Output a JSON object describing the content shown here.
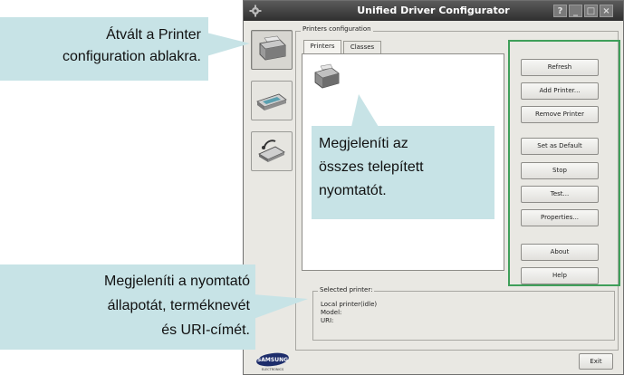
{
  "window": {
    "title": "Unified Driver Configurator",
    "controls": [
      "?",
      "_",
      "□",
      "×"
    ]
  },
  "nav": {
    "items": [
      {
        "name": "printer",
        "active": true
      },
      {
        "name": "scanner",
        "active": false
      },
      {
        "name": "ports",
        "active": false
      }
    ]
  },
  "printers_config": {
    "group_label": "Printers configuration",
    "tabs": [
      {
        "label": "Printers",
        "active": true
      },
      {
        "label": "Classes",
        "active": false
      }
    ],
    "buttons": {
      "refresh": "Refresh",
      "add_printer": "Add Printer...",
      "remove_printer": "Remove Printer",
      "set_default": "Set as Default",
      "stop": "Stop",
      "test": "Test...",
      "properties": "Properties...",
      "about": "About",
      "help": "Help"
    }
  },
  "selected": {
    "label": "Selected printer:",
    "line1": "Local printer(idle)",
    "line2": "Model:",
    "line3": "URI:"
  },
  "footer": {
    "exit": "Exit",
    "logo": "SAMSUNG ELECTRONICS"
  },
  "callouts": {
    "top_line1": "Átvált a Printer",
    "top_line2": "configuration ablakra.",
    "mid_line1": "Megjeleníti az",
    "mid_line2": "összes telepített",
    "mid_line3": "nyomtatót.",
    "bottom_line1": "Megjeleníti a nyomtató",
    "bottom_line2": "állapotát, terméknevét",
    "bottom_line3": "és URI-címét."
  },
  "colors": {
    "callout_bg": "#c7e3e6",
    "highlight_border": "#3f9f5a",
    "titlebar": "#3a3a3a"
  }
}
